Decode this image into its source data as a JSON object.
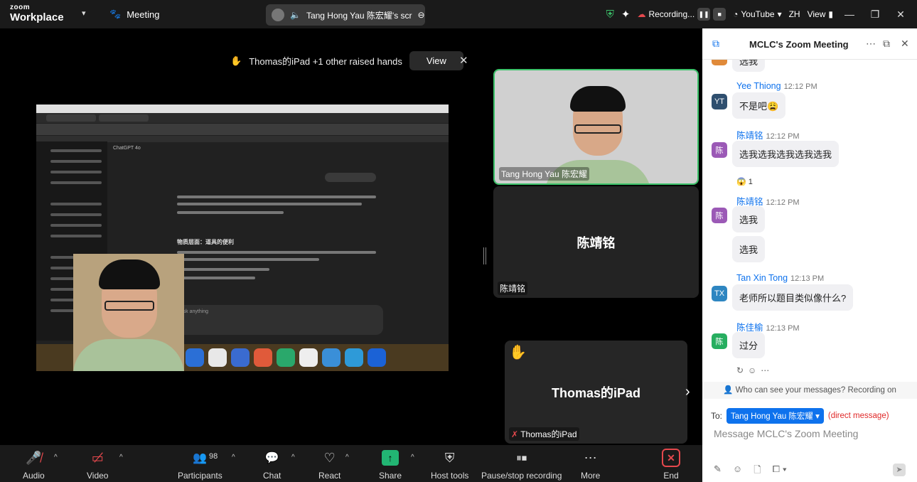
{
  "brand": {
    "line1": "zoom",
    "line2": "Workplace"
  },
  "topbar": {
    "meeting_label": "Meeting",
    "share_title": "Tang Hong Yau 陈宏耀's scr",
    "recording_label": "Recording...",
    "youtube_label": "YouTube",
    "lang_label": "ZH",
    "view_label": "View"
  },
  "raised_hands": {
    "text": "Thomas的iPad +1 other raised hands",
    "view_button": "View"
  },
  "tiles": {
    "tang": {
      "name": "Tang Hong Yau 陈宏耀"
    },
    "chen": {
      "center_name": "陈靖铭",
      "name": "陈靖铭"
    },
    "thomas": {
      "center_name": "Thomas的iPad",
      "name": "Thomas的iPad"
    }
  },
  "toolbar": {
    "audio": "Audio",
    "video": "Video",
    "participants": "Participants",
    "participants_count": "98",
    "chat": "Chat",
    "react": "React",
    "share": "Share",
    "host_tools": "Host tools",
    "pause_rec": "Pause/stop recording",
    "more": "More",
    "end": "End"
  },
  "chat": {
    "title": "MCLC's Zoom Meeting",
    "partial_top": "选我",
    "messages": [
      {
        "avatar": "YT",
        "avatar_color": "#2f4f6f",
        "sender": "Yee Thiong",
        "time": "12:12 PM",
        "text": "不是吧😩"
      },
      {
        "avatar": "陈",
        "avatar_color": "#9b59b6",
        "sender": "陈靖铭",
        "time": "12:12 PM",
        "text": "选我选我选我选我选我",
        "reaction": "😱 1"
      },
      {
        "avatar": "陈",
        "avatar_color": "#9b59b6",
        "sender": "陈靖铭",
        "time": "12:12 PM",
        "text": "选我",
        "text2": "选我"
      },
      {
        "avatar": "TX",
        "avatar_color": "#2e86c1",
        "sender": "Tan Xin Tong",
        "time": "12:13 PM",
        "text": "老师所以题目类似像什么?"
      },
      {
        "avatar": "陈",
        "avatar_color": "#27ae60",
        "sender": "陈佳榆",
        "time": "12:13 PM",
        "text": "过分"
      }
    ],
    "who_can_see": "Who can see your messages? Recording on",
    "to_label": "To:",
    "to_recipient": "Tang Hong Yau 陈宏耀",
    "direct_label": "(direct message)",
    "input_placeholder": "Message MCLC's Zoom Meeting"
  },
  "screenshot": {
    "gpt_model": "ChatGPT 4o",
    "gpt_heading": "物质层面：道具的便利",
    "gpt_input": "Ask anything"
  },
  "colors": {
    "accent": "#0e72ed",
    "active_speaker": "#3cc36a",
    "end": "#e5484d",
    "share": "#22b573"
  }
}
